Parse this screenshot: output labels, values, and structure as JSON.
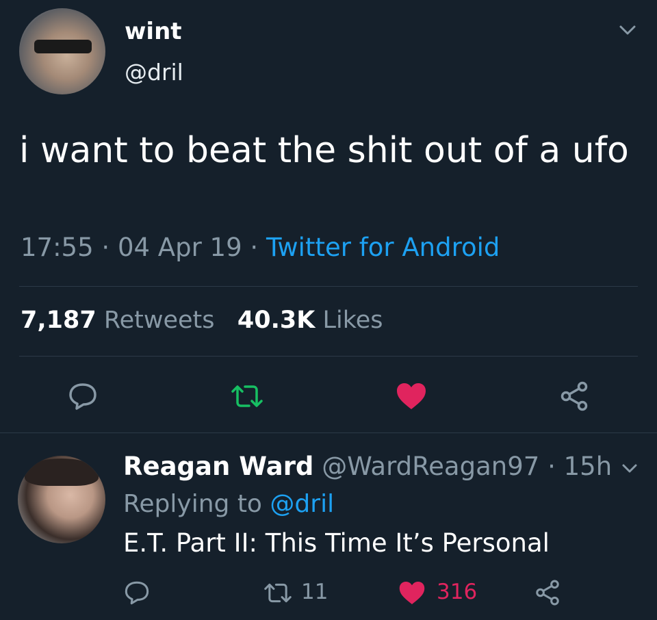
{
  "tweet": {
    "display_name": "wint",
    "handle": "@dril",
    "text": "i want to beat the shit out of a ufo",
    "time": "17:55",
    "date": "04 Apr 19",
    "source": "Twitter for Android",
    "retweets": "7,187",
    "retweets_label": "Retweets",
    "likes": "40.3K",
    "likes_label": "Likes"
  },
  "reply": {
    "display_name": "Reagan Ward",
    "handle": "@WardReagan97",
    "age": "15h",
    "replying_to_label": "Replying to",
    "replying_to_handle": "@dril",
    "text": "E.T. Part II: This Time It’s Personal",
    "retweet_count": "11",
    "like_count": "316"
  },
  "colors": {
    "background": "#15202b",
    "link": "#1da1f2",
    "muted": "#8899a6",
    "retweet_active": "#17bf63",
    "like_active": "#e0245e"
  },
  "icons": [
    "chevron-down-icon",
    "reply-icon",
    "retweet-icon",
    "heart-icon",
    "share-icon"
  ]
}
